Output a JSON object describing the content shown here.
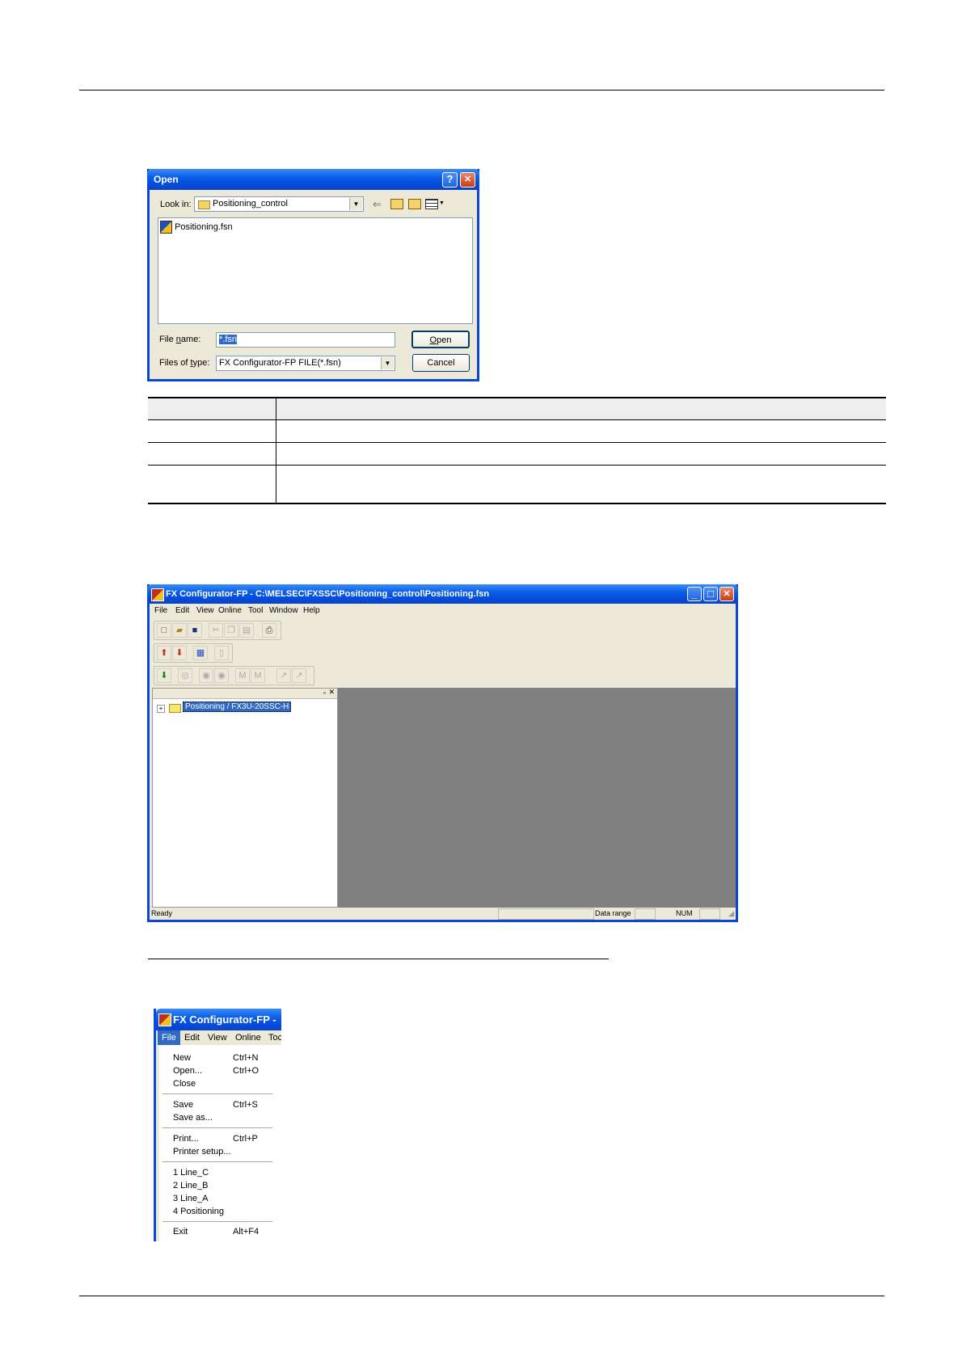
{
  "open_dialog": {
    "title": "Open",
    "help_button": "?",
    "close_button": "✕",
    "look_in_label": "Look in:",
    "look_in_value": "Positioning_control",
    "files": [
      "Positioning.fsn"
    ],
    "file_name_label": "File name:",
    "file_name_value": "*.fsn",
    "files_of_type_label": "Files of type:",
    "files_of_type_value": "FX Configurator-FP FILE(*.fsn)",
    "open_button": "Open",
    "cancel_button": "Cancel"
  },
  "main_window": {
    "title": "FX Configurator-FP - C:\\MELSEC\\FXSSC\\Positioning_control\\Positioning.fsn",
    "menu": [
      "File",
      "Edit",
      "View",
      "Online",
      "Tool",
      "Window",
      "Help"
    ],
    "tree_item": "Positioning / FX3U-20SSC-H",
    "status_ready": "Ready",
    "status_data_range": "Data range",
    "status_num": "NUM"
  },
  "file_menu_window": {
    "title": "FX Configurator-FP -",
    "menu": [
      "File",
      "Edit",
      "View",
      "Online",
      "Toc"
    ],
    "items": [
      {
        "label": "New",
        "shortcut": "Ctrl+N"
      },
      {
        "label": "Open...",
        "shortcut": "Ctrl+O"
      },
      {
        "label": "Close",
        "shortcut": ""
      },
      {
        "label": "Save",
        "shortcut": "Ctrl+S"
      },
      {
        "label": "Save as...",
        "shortcut": ""
      },
      {
        "label": "Print...",
        "shortcut": "Ctrl+P"
      },
      {
        "label": "Printer setup...",
        "shortcut": ""
      },
      {
        "label": "1 Line_C",
        "shortcut": ""
      },
      {
        "label": "2 Line_B",
        "shortcut": ""
      },
      {
        "label": "3 Line_A",
        "shortcut": ""
      },
      {
        "label": "4 Positioning",
        "shortcut": ""
      },
      {
        "label": "Exit",
        "shortcut": "Alt+F4"
      }
    ]
  },
  "colors": {
    "xp_blue": "#0a5ee8",
    "workspace_gray": "#808080",
    "selection": "#316ac5"
  }
}
